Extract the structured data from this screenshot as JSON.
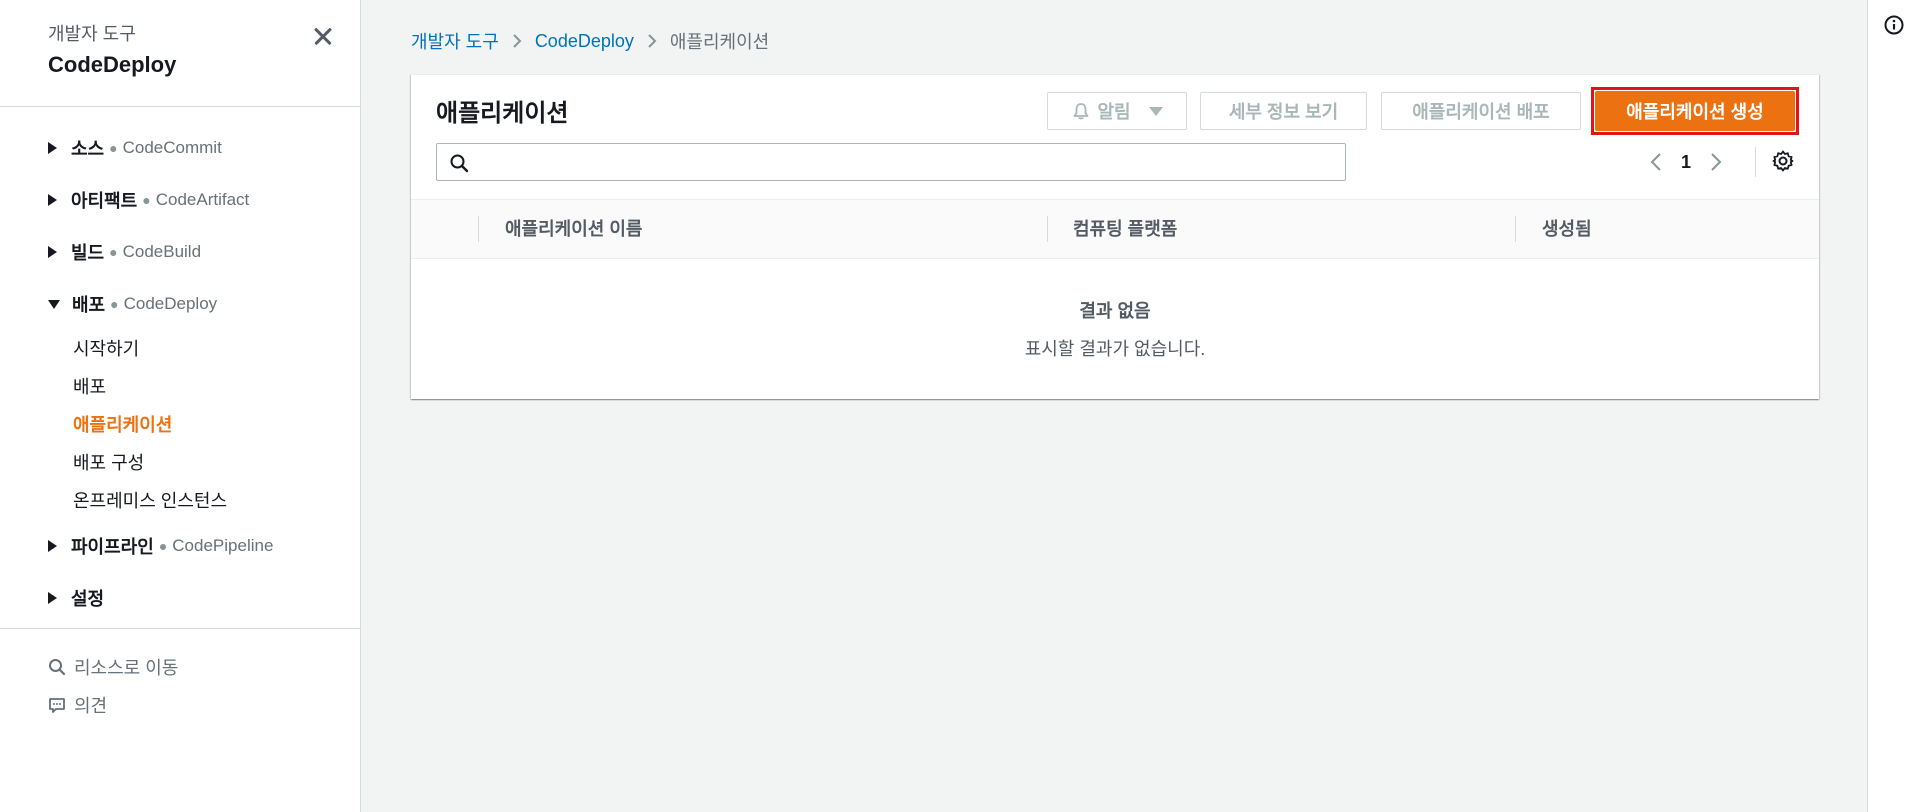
{
  "sidebar": {
    "overline": "개발자 도구",
    "title": "CodeDeploy",
    "sections": [
      {
        "label": "소스",
        "sub": "CodeCommit"
      },
      {
        "label": "아티팩트",
        "sub": "CodeArtifact"
      },
      {
        "label": "빌드",
        "sub": "CodeBuild"
      },
      {
        "label": "배포",
        "sub": "CodeDeploy"
      },
      {
        "label": "파이프라인",
        "sub": "CodePipeline"
      },
      {
        "label": "설정"
      }
    ],
    "deploy_items": [
      "시작하기",
      "배포",
      "애플리케이션",
      "배포 구성",
      "온프레미스 인스턴스"
    ],
    "footer": {
      "go_to_resource": "리소스로 이동",
      "feedback": "의견"
    }
  },
  "breadcrumb": [
    "개발자 도구",
    "CodeDeploy",
    "애플리케이션"
  ],
  "panel": {
    "title": "애플리케이션",
    "notify_label": "알림",
    "details_label": "세부 정보 보기",
    "deploy_label": "애플리케이션 배포",
    "create_label": "애플리케이션 생성",
    "search_value": "",
    "search_placeholder": "",
    "page": "1"
  },
  "table": {
    "columns": [
      "애플리케이션 이름",
      "컴퓨팅 플랫폼",
      "생성됨"
    ],
    "empty_title": "결과 없음",
    "empty_desc": "표시할 결과가 없습니다."
  },
  "icons": {
    "close": "close-icon",
    "search": "search-icon",
    "bell": "bell-icon",
    "settings": "gear-icon",
    "info": "info-icon",
    "feedback": "feedback-icon"
  },
  "colors": {
    "accent": "#ec7211",
    "link": "#0073bb",
    "highlight": "#e0141a"
  }
}
